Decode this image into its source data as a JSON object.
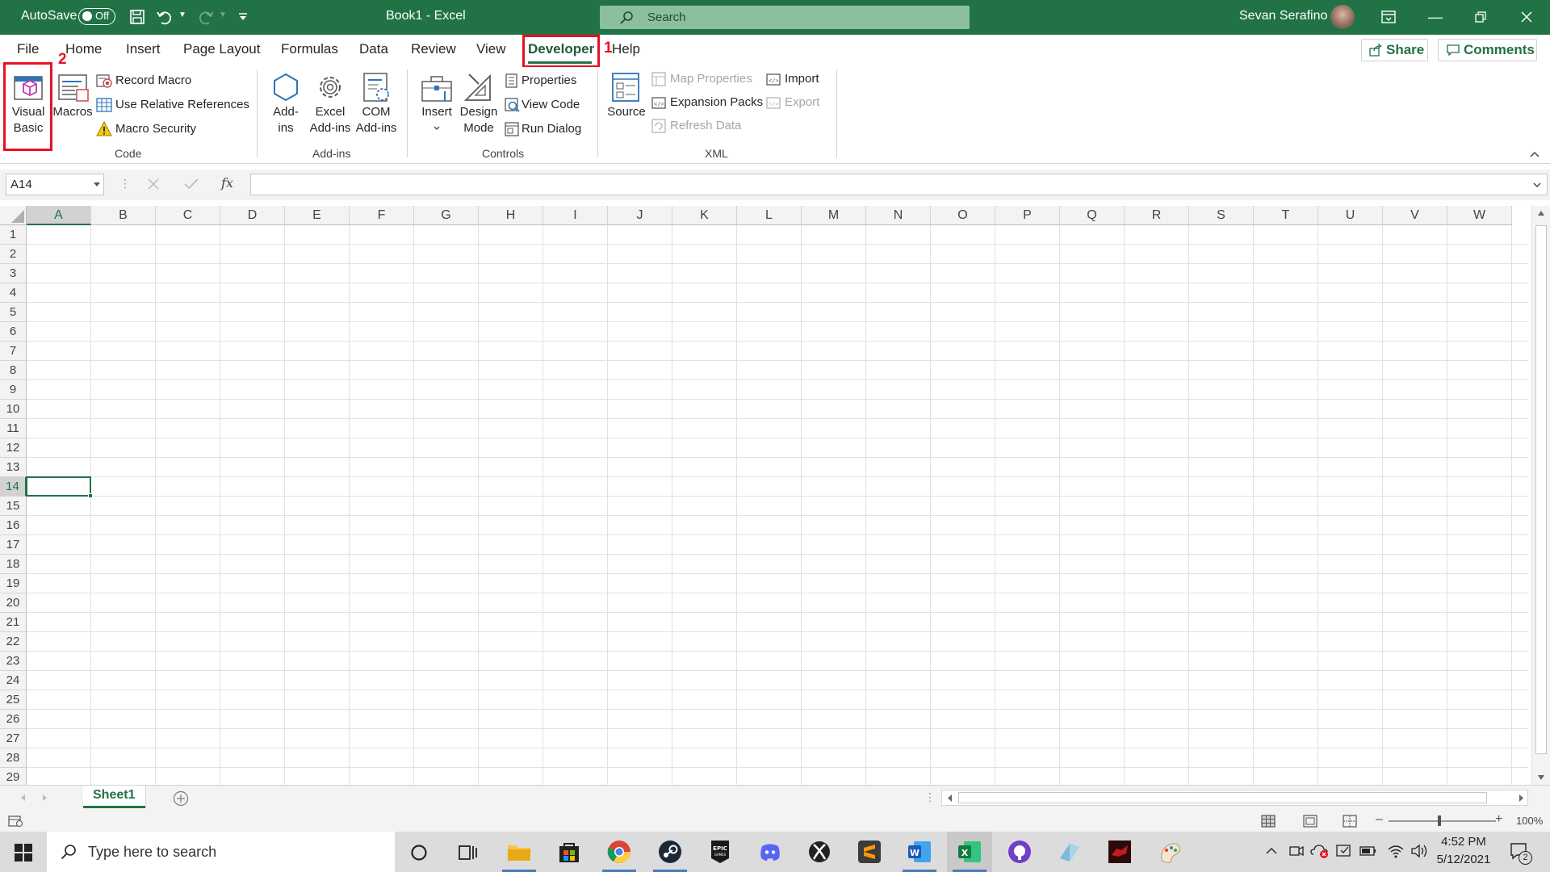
{
  "titlebar": {
    "autosave_label": "AutoSave",
    "autosave_state": "Off",
    "doc_title": "Book1  -  Excel",
    "search_placeholder": "Search",
    "user_name": "Sevan Serafino"
  },
  "ribbon_tabs": [
    "File",
    "Home",
    "Insert",
    "Page Layout",
    "Formulas",
    "Data",
    "Review",
    "View",
    "Developer",
    "Help"
  ],
  "active_tab": "Developer",
  "share_label": "Share",
  "comments_label": "Comments",
  "annotations": {
    "marker_1": "1",
    "marker_2": "2"
  },
  "groups": {
    "code": {
      "label": "Code",
      "visual_basic": "Visual Basic",
      "macros": "Macros",
      "record_macro": "Record Macro",
      "use_relative": "Use Relative References",
      "macro_security": "Macro Security"
    },
    "addins": {
      "label": "Add-ins",
      "addins": "Add-ins",
      "excel_addins": "Excel Add-ins",
      "com_addins": "COM Add-ins"
    },
    "controls": {
      "label": "Controls",
      "insert": "Insert",
      "design_mode": "Design Mode",
      "properties": "Properties",
      "view_code": "View Code",
      "run_dialog": "Run Dialog"
    },
    "xml": {
      "label": "XML",
      "source": "Source",
      "map_properties": "Map Properties",
      "expansion_packs": "Expansion Packs",
      "refresh_data": "Refresh Data",
      "import": "Import",
      "export": "Export"
    }
  },
  "formula_bar": {
    "name_box": "A14",
    "fx": "fx",
    "value": ""
  },
  "columns": [
    "A",
    "B",
    "C",
    "D",
    "E",
    "F",
    "G",
    "H",
    "I",
    "J",
    "K",
    "L",
    "M",
    "N",
    "O",
    "P",
    "Q",
    "R",
    "S",
    "T",
    "U",
    "V",
    "W"
  ],
  "rows": [
    "1",
    "2",
    "3",
    "4",
    "5",
    "6",
    "7",
    "8",
    "9",
    "10",
    "11",
    "12",
    "13",
    "14",
    "15",
    "16",
    "17",
    "18",
    "19",
    "20",
    "21",
    "22",
    "23",
    "24",
    "25",
    "26",
    "27",
    "28",
    "29"
  ],
  "selected_cell": {
    "column": "A",
    "row": "14"
  },
  "sheet_tabs": [
    "Sheet1"
  ],
  "zoom": "100%",
  "taskbar": {
    "search_placeholder": "Type here to search",
    "time": "4:52 PM",
    "date": "5/12/2021",
    "notification_count": "2"
  },
  "colors": {
    "excel_green": "#217346",
    "annotation_red": "#e81123"
  }
}
